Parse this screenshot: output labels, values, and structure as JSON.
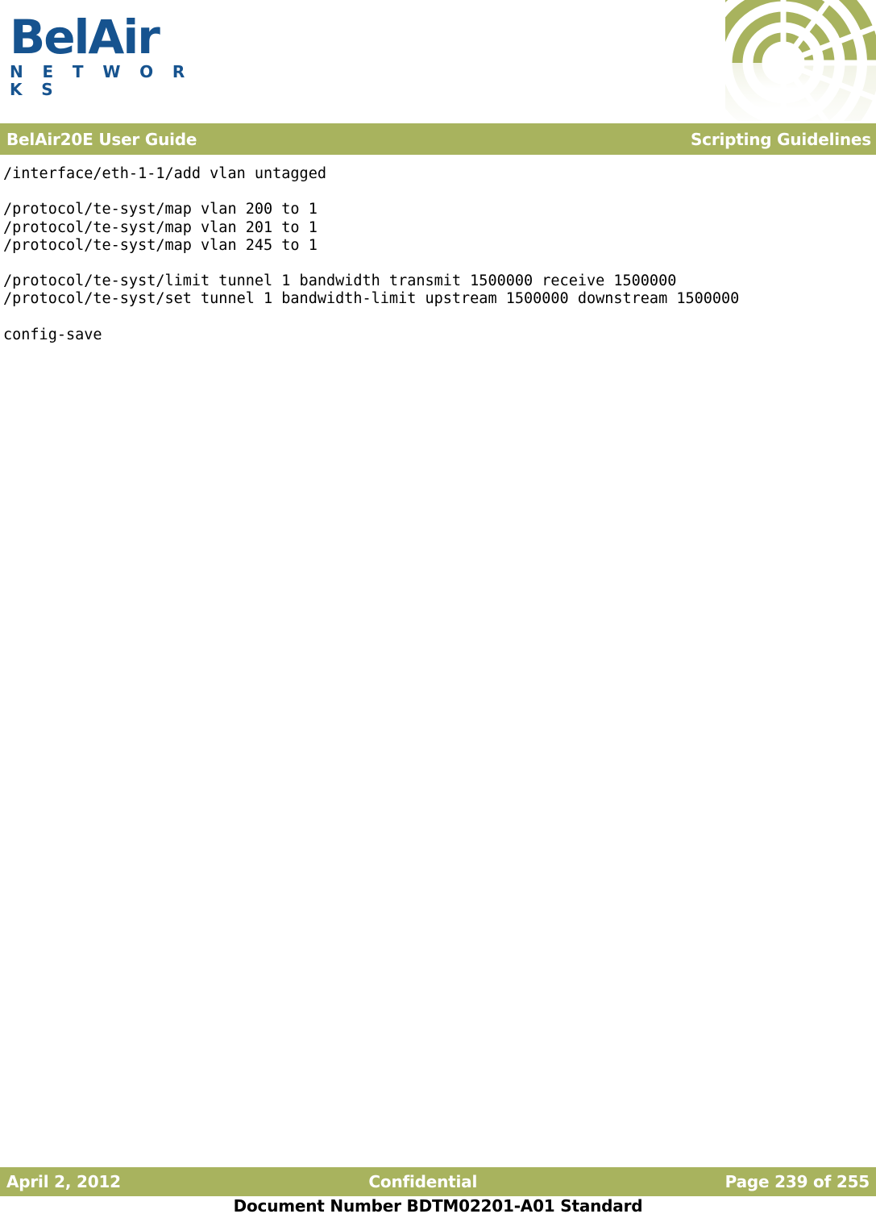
{
  "brand": {
    "logo_primary": "BelAir",
    "logo_secondary": "N E T W O R K S",
    "logo_color": "#16538f",
    "accent_color": "#a8b35e",
    "mark_icon": "radiating-arcs-icon"
  },
  "header": {
    "title": "BelAir20E User Guide",
    "section": "Scripting Guidelines"
  },
  "body": {
    "code_lines": [
      "/interface/eth-1-1/add vlan untagged",
      "",
      "/protocol/te-syst/map vlan 200 to 1",
      "/protocol/te-syst/map vlan 201 to 1",
      "/protocol/te-syst/map vlan 245 to 1",
      "",
      "/protocol/te-syst/limit tunnel 1 bandwidth transmit 1500000 receive 1500000",
      "/protocol/te-syst/set tunnel 1 bandwidth-limit upstream 1500000 downstream 1500000",
      "",
      "config-save"
    ]
  },
  "footer": {
    "date": "April 2, 2012",
    "classification": "Confidential",
    "page": "Page 239 of 255",
    "document_number": "Document Number BDTM02201-A01 Standard"
  }
}
